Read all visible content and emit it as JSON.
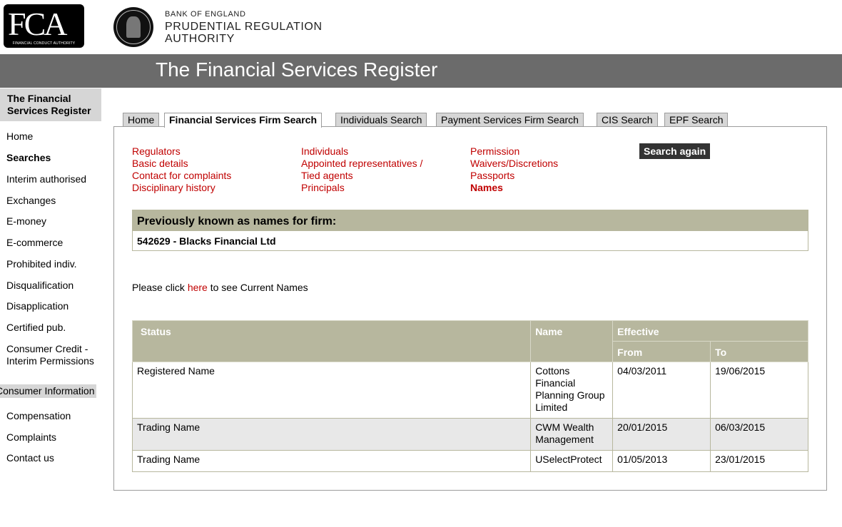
{
  "header": {
    "fca_logo_text": "FCA",
    "fca_logo_sub": "FINANCIAL CONDUCT AUTHORITY",
    "pra_line1": "BANK OF ENGLAND",
    "pra_line2": "PRUDENTIAL REGULATION",
    "pra_line3": "AUTHORITY",
    "banner_title": "The Financial Services Register"
  },
  "sidebar": {
    "box_title": "The Financial Services Register",
    "items": [
      "Home",
      "Searches",
      "Interim authorised",
      "Exchanges",
      "E-money",
      "E-commerce",
      "Prohibited indiv.",
      "Disqualification",
      "Disapplication",
      "Certified pub.",
      "Consumer Credit - Interim Permissions"
    ],
    "consumer_header": "Consumer Information",
    "consumer_items": [
      "Compensation",
      "Complaints",
      "Contact us"
    ]
  },
  "tabs": [
    "Home",
    "Financial Services Firm Search",
    "Individuals Search",
    "Payment Services Firm Search",
    "CIS Search",
    "EPF Search"
  ],
  "links": {
    "col1": [
      "Regulators",
      "Basic details",
      "Contact for complaints",
      "Disciplinary history"
    ],
    "col2": [
      "Individuals",
      "Appointed representatives /",
      "Tied agents",
      "Principals"
    ],
    "col3": [
      "Permission",
      "Waivers/Discretions",
      "Passports",
      "Names"
    ]
  },
  "search_again": "Search again",
  "previous_names": {
    "heading": "Previously known as names for firm:",
    "firm": "542629 - Blacks Financial Ltd"
  },
  "click_line": {
    "prefix": "Please click ",
    "link": "here",
    "suffix": " to see Current Names"
  },
  "names_table": {
    "headers": {
      "status": "Status",
      "name": "Name",
      "effective": "Effective",
      "from": "From",
      "to": "To"
    },
    "rows": [
      {
        "status": "Registered Name",
        "name": "Cottons Financial Planning Group Limited",
        "from": "04/03/2011",
        "to": "19/06/2015"
      },
      {
        "status": "Trading Name",
        "name": "CWM Wealth Management",
        "from": "20/01/2015",
        "to": "06/03/2015"
      },
      {
        "status": "Trading Name",
        "name": "USelectProtect",
        "from": "01/05/2013",
        "to": "23/01/2015"
      }
    ]
  },
  "colors": {
    "banner": "#6b6b6b",
    "link_red": "#c00000",
    "table_header": "#b7b79e",
    "sidebar_box": "#d6d6d6"
  }
}
